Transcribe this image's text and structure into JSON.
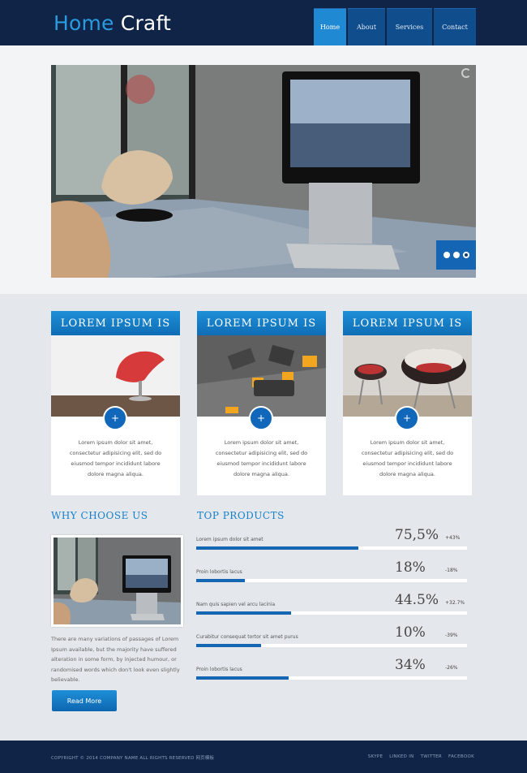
{
  "header": {
    "logo_part1": "Home",
    "logo_part2": "Craft",
    "nav": [
      {
        "label": "Home",
        "active": true
      },
      {
        "label": "About",
        "active": false
      },
      {
        "label": "Services",
        "active": false
      },
      {
        "label": "Contact",
        "active": false
      }
    ]
  },
  "slider": {
    "dot_count": 3,
    "active_dot": 3
  },
  "cards": [
    {
      "title": "LOREM IPSUM IS",
      "plus": "+",
      "text": "Lorem ipsum dolor sit amet, consectetur adipisicing elit, sed do eiusmod tempor incididunt labore dolore magna aliqua."
    },
    {
      "title": "LOREM IPSUM IS",
      "plus": "+",
      "text": "Lorem ipsum dolor sit amet, consectetur adipisicing elit, sed do eiusmod tempor incididunt labore dolore magna aliqua."
    },
    {
      "title": "LOREM IPSUM IS",
      "plus": "+",
      "text": "Lorem ipsum dolor sit amet, consectetur adipisicing elit, sed do eiusmod tempor incididunt labore dolore magna aliqua."
    }
  ],
  "why": {
    "title": "WHY CHOOSE US",
    "text": "There are many variations of passages of Lorem Ipsum available, but the majority have suffered alteration in some form, by injected humour, or randomised words which don't look even slightly believable.",
    "button": "Read More"
  },
  "products": {
    "title": "TOP PRODUCTS",
    "items": [
      {
        "name": "Lorem ipsum dolor sit amet",
        "value": "75,5%",
        "change": "+43%",
        "fill": 0.6
      },
      {
        "name": "Proin lobortis lacus",
        "value": "18%",
        "change": "-18%",
        "fill": 0.18
      },
      {
        "name": "Nam quis sapien vel arcu lacinia",
        "value": "44.5%",
        "change": "+32.7%",
        "fill": 0.35
      },
      {
        "name": "Curabitur consequat tortor sit amet purus",
        "value": "10%",
        "change": "-39%",
        "fill": 0.24
      },
      {
        "name": "Proin lobortis lacus",
        "value": "34%",
        "change": "-26%",
        "fill": 0.34
      }
    ]
  },
  "footer": {
    "copyright": "COPYRIGHT © 2014 COMPANY NAME ALL RIGHTS RESERVED 网页模板",
    "social": [
      "SKYPE",
      "LINKED IN",
      "TWITTER",
      "FACEBOOK"
    ]
  },
  "colors": {
    "accent": "#1680cc",
    "navy": "#0f2446",
    "nav_active": "#1f8ad3"
  }
}
